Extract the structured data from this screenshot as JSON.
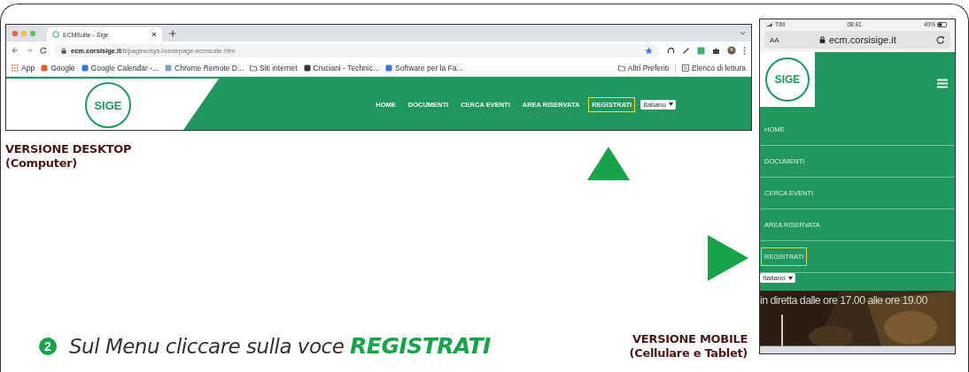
{
  "desktop": {
    "label": "VERSIONE DESKTOP",
    "sublabel": "(Computer)",
    "browser": {
      "tab_title": "ECMSuite - Sige",
      "url": "**ecm.corsisige.it**/it/pagine/sys-homepage-ecmsuite.htm",
      "bookmarks": [
        "App",
        "Google",
        "Google Calendar -...",
        "Chrome Remote D...",
        "Siti internet",
        "Cruciani - Technic...",
        "Software per la Fa..."
      ],
      "bookmarks_right": [
        "Altri Preferiti",
        "Elenco di lettura"
      ]
    },
    "site": {
      "logo": "SIGE",
      "language": "Italiano",
      "nav": [
        {
          "label": "HOME",
          "selected": false
        },
        {
          "label": "DOCUMENTI",
          "selected": false
        },
        {
          "label": "CERCA EVENTI",
          "selected": false
        },
        {
          "label": "AREA RISERVATA",
          "selected": false
        },
        {
          "label": "REGISTRATI",
          "selected": true
        }
      ]
    }
  },
  "mobile": {
    "label": "VERSIONE MOBILE",
    "sublabel": "(Cellulare e Tablet)",
    "status_bar": {
      "carrier": "TIM",
      "time": "08:41",
      "battery": "40%"
    },
    "address_bar": {
      "text_size": "AA",
      "host": "ecm.corsisige.it"
    },
    "site": {
      "logo": "SIGE",
      "language": "Italiano",
      "banner": "in diretta dalle ore 17.00 alle ore 19.00",
      "nav": [
        {
          "label": "HOME",
          "selected": false
        },
        {
          "label": "DOCUMENTI",
          "selected": false
        },
        {
          "label": "CERCA EVENTI",
          "selected": false
        },
        {
          "label": "AREA RISERVATA",
          "selected": false
        },
        {
          "label": "REGISTRATI",
          "selected": true
        }
      ]
    }
  },
  "step": {
    "number": "2",
    "text": "Sul Menu cliccare sulla voce",
    "keyword": "REGISTRATI"
  }
}
